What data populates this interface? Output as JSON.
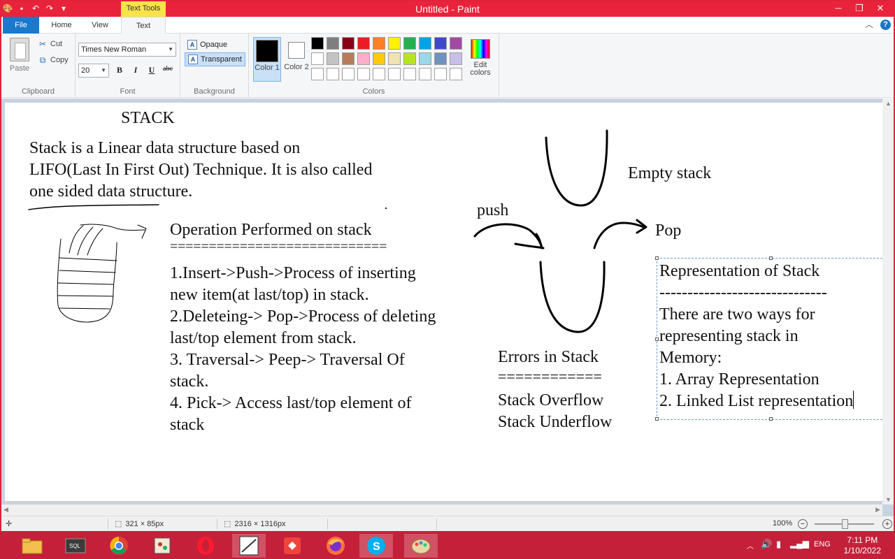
{
  "window": {
    "title": "Untitled - Paint",
    "contextual_tab": "Text Tools",
    "controls": [
      "─",
      "❐",
      "✕"
    ]
  },
  "tabs": [
    {
      "label": "File"
    },
    {
      "label": "Home"
    },
    {
      "label": "View"
    },
    {
      "label": "Text"
    }
  ],
  "ribbon": {
    "clipboard": {
      "label": "Clipboard",
      "paste": "Paste",
      "cut": "Cut",
      "copy": "Copy"
    },
    "font": {
      "label": "Font",
      "family": "Times New Roman",
      "size": "20",
      "bold": "B",
      "italic": "I",
      "underline": "U",
      "strike": "abc"
    },
    "background": {
      "label": "Background",
      "opaque": "Opaque",
      "transparent": "Transparent"
    },
    "colors": {
      "label": "Colors",
      "color1_label": "Color 1",
      "color2_label": "Color 2",
      "color1": "#000000",
      "color2": "#ffffff",
      "edit_label": "Edit colors",
      "palette": [
        "#000000",
        "#7f7f7f",
        "#880015",
        "#ed1c24",
        "#ff7f27",
        "#fff200",
        "#22b14c",
        "#00a2e8",
        "#3f48cc",
        "#a349a4",
        "#ffffff",
        "#c3c3c3",
        "#b97a57",
        "#ffaec9",
        "#ffc90e",
        "#efe4b0",
        "#b5e61d",
        "#99d9ea",
        "#7092be",
        "#c8bfe7",
        "#ffffff",
        "#ffffff",
        "#ffffff",
        "#ffffff",
        "#ffffff",
        "#ffffff",
        "#ffffff",
        "#ffffff",
        "#ffffff",
        "#ffffff"
      ]
    }
  },
  "canvas": {
    "heading": "STACK",
    "intro": [
      "Stack is a Linear data structure based on",
      "LIFO(Last In First Out) Technique. It is also called",
      "one sided data structure."
    ],
    "operations": {
      "title": "Operation Performed on stack",
      "rule": "============================",
      "lines": [
        "1.Insert->Push->Process of inserting",
        "new item(at last/top) in stack.",
        "2.Deleteing-> Pop->Process of deleting",
        "last/top element from stack.",
        "3. Traversal-> Peep-> Traversal Of",
        "stack.",
        "4. Pick-> Access last/top element of",
        "stack"
      ]
    },
    "empty_stack": "Empty stack",
    "push": "push",
    "pop": "Pop",
    "errors": {
      "title": "Errors in Stack",
      "rule": "============",
      "items": [
        "Stack Overflow",
        "Stack Underflow"
      ]
    },
    "representation": {
      "title": "Representation of Stack",
      "rule": "------------------------------",
      "lines": [
        "There are two ways for",
        "representing stack in",
        "Memory:",
        "1. Array Representation",
        "2. Linked List representation"
      ]
    }
  },
  "status": {
    "selection": "321 × 85px",
    "canvas_size": "2316 × 1316px",
    "zoom": "100%"
  },
  "taskbar": {
    "time": "7:11 PM",
    "date": "1/10/2022",
    "lang": "ENG"
  }
}
